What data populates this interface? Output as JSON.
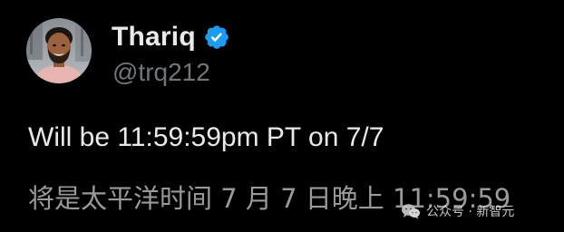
{
  "tweet": {
    "author": {
      "name": "Thariq",
      "handle": "@trq212",
      "verified": true,
      "verified_color": "#1d9bf0"
    },
    "text_en": "Will be 11:59:59pm PT on 7/7",
    "text_zh": "将是太平洋时间 7 月 7 日晚上 11:59:59"
  },
  "watermark": {
    "text": "公众号 · 新智元"
  },
  "colors": {
    "background": "#000000",
    "primary_text": "#e7e9ea",
    "secondary_text": "#71767b",
    "translation_text": "#9a9a9a"
  }
}
